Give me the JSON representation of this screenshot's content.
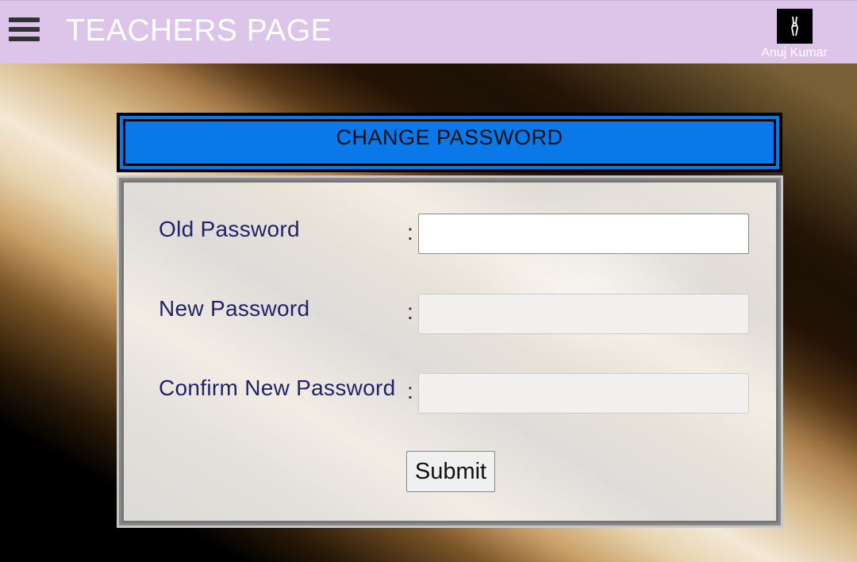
{
  "topbar": {
    "title": "TEACHERS PAGE",
    "menu_icon": "hamburger-menu-icon",
    "user_name": "Anuj Kumar",
    "avatar_icon": "user-avatar-icon"
  },
  "form": {
    "heading": "CHANGE PASSWORD",
    "fields": [
      {
        "label": "Old Password",
        "separator": ":",
        "value": ""
      },
      {
        "label": "New Password",
        "separator": ":",
        "value": ""
      },
      {
        "label": "Confirm New Password",
        "separator": ":",
        "value": ""
      }
    ],
    "submit_label": "Submit"
  },
  "colors": {
    "topbar_bg": "#dcc5e8",
    "heading_bg": "#0a78e8",
    "label_color": "#22226a"
  }
}
